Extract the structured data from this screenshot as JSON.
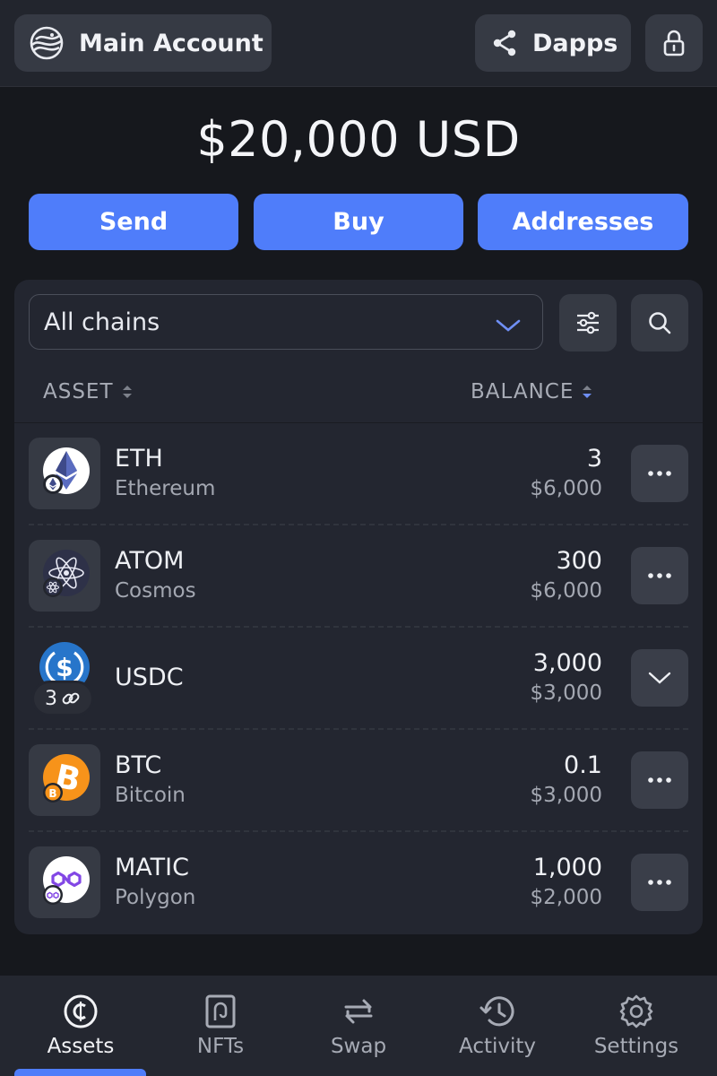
{
  "header": {
    "account_label": "Main Account",
    "dapps_label": "Dapps"
  },
  "balance": {
    "total": "$20,000 USD"
  },
  "actions": {
    "send": "Send",
    "buy": "Buy",
    "addresses": "Addresses"
  },
  "filters": {
    "chain_selected": "All chains"
  },
  "table": {
    "col_asset": "ASSET",
    "col_balance": "BALANCE",
    "rows": [
      {
        "symbol": "ETH",
        "network": "Ethereum",
        "amount": "3",
        "usd": "$6,000"
      },
      {
        "symbol": "ATOM",
        "network": "Cosmos",
        "amount": "300",
        "usd": "$6,000"
      },
      {
        "symbol": "USDC",
        "network": "",
        "amount": "3,000",
        "usd": "$3,000",
        "chain_count": "3"
      },
      {
        "symbol": "BTC",
        "network": "Bitcoin",
        "amount": "0.1",
        "usd": "$3,000"
      },
      {
        "symbol": "MATIC",
        "network": "Polygon",
        "amount": "1,000",
        "usd": "$2,000"
      }
    ]
  },
  "nav": {
    "assets": "Assets",
    "nfts": "NFTs",
    "swap": "Swap",
    "activity": "Activity",
    "settings": "Settings"
  },
  "colors": {
    "accent": "#4f7dfa",
    "background": "#16181d",
    "surface": "#232630",
    "eth": "#627eea",
    "atom": "#2e3148",
    "usdc": "#2775ca",
    "btc": "#f7931a",
    "matic": "#8247e5"
  },
  "icons": {
    "account": "wave-logo-icon",
    "dapps": "share-icon",
    "lock": "lock-icon",
    "chain_select": "chevron-down-icon",
    "filter": "sliders-icon",
    "search": "search-icon",
    "row_more": "more-horizontal-icon",
    "row_expand": "chevron-down-icon",
    "usdc_chains": "link-icon",
    "nav_assets": "coin-icon",
    "nav_nfts": "nft-icon",
    "nav_swap": "swap-icon",
    "nav_activity": "history-icon",
    "nav_settings": "gear-icon"
  }
}
